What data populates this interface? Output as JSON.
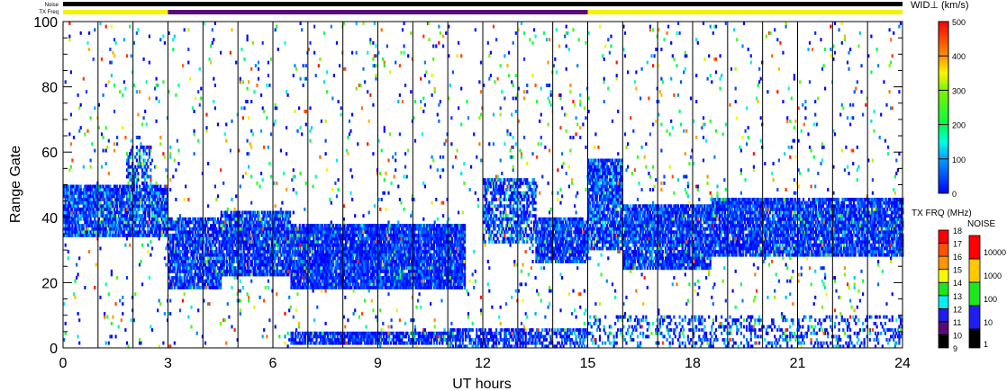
{
  "chart_data": {
    "type": "heatmap",
    "title": "",
    "xlabel": "UT hours",
    "ylabel": "Range Gate",
    "xlim": [
      0,
      24
    ],
    "ylim": [
      0,
      100
    ],
    "x_ticks": [
      "0",
      "3",
      "6",
      "9",
      "12",
      "15",
      "18",
      "21",
      "24"
    ],
    "y_ticks": [
      "0",
      "20",
      "40",
      "60",
      "80",
      "100"
    ],
    "hour_gridlines": true,
    "status_bars": {
      "noise_label": "Noise",
      "txfreq_label": "TX Freq",
      "noise_segments": [
        {
          "from": 0,
          "to": 24,
          "color": "#000000"
        }
      ],
      "txfreq_segments": [
        {
          "from": 0,
          "to": 3,
          "color": "#f2f200"
        },
        {
          "from": 3,
          "to": 15,
          "color": "#5a0a78"
        },
        {
          "from": 15,
          "to": 24,
          "color": "#f2f200"
        }
      ]
    },
    "parameter": {
      "label": "WID⊥ (km/s)",
      "range": [
        0,
        500
      ],
      "ticks": [
        "0",
        "100",
        "200",
        "300",
        "400",
        "500"
      ]
    },
    "scatter_regions": [
      {
        "t0": 0,
        "t1": 3,
        "g0": 34,
        "g1": 50,
        "density": 0.85,
        "width": [
          0,
          150
        ]
      },
      {
        "t0": 1.8,
        "t1": 2.5,
        "g0": 50,
        "g1": 62,
        "density": 0.5,
        "width": [
          0,
          200
        ]
      },
      {
        "t0": 3,
        "t1": 4.5,
        "g0": 18,
        "g1": 40,
        "density": 0.8,
        "width": [
          0,
          120
        ]
      },
      {
        "t0": 4.5,
        "t1": 6.5,
        "g0": 22,
        "g1": 42,
        "density": 0.85,
        "width": [
          0,
          120
        ]
      },
      {
        "t0": 6.5,
        "t1": 11.5,
        "g0": 18,
        "g1": 38,
        "density": 0.9,
        "width": [
          0,
          100
        ]
      },
      {
        "t0": 6.5,
        "t1": 11,
        "g0": 1,
        "g1": 5,
        "density": 0.8,
        "width": [
          0,
          80
        ]
      },
      {
        "t0": 11,
        "t1": 15,
        "g0": 0,
        "g1": 6,
        "density": 0.6,
        "width": [
          0,
          120
        ]
      },
      {
        "t0": 12,
        "t1": 13.5,
        "g0": 32,
        "g1": 52,
        "density": 0.6,
        "width": [
          0,
          150
        ]
      },
      {
        "t0": 13.5,
        "t1": 15,
        "g0": 26,
        "g1": 40,
        "density": 0.85,
        "width": [
          0,
          120
        ]
      },
      {
        "t0": 15,
        "t1": 16,
        "g0": 30,
        "g1": 58,
        "density": 0.8,
        "width": [
          0,
          150
        ]
      },
      {
        "t0": 16,
        "t1": 18.5,
        "g0": 24,
        "g1": 44,
        "density": 0.85,
        "width": [
          0,
          120
        ]
      },
      {
        "t0": 18.5,
        "t1": 24,
        "g0": 28,
        "g1": 46,
        "density": 0.85,
        "width": [
          0,
          120
        ]
      },
      {
        "t0": 15,
        "t1": 24,
        "g0": 0,
        "g1": 10,
        "density": 0.25,
        "width": [
          0,
          150
        ]
      },
      {
        "t0": 0,
        "t1": 24,
        "g0": 0,
        "g1": 100,
        "density": 0.03,
        "width": [
          0,
          500
        ]
      }
    ],
    "txfreq_scale": {
      "label": "TX FRQ (MHz)",
      "ticks": [
        "9",
        "10",
        "11",
        "12",
        "13",
        "14",
        "15",
        "16",
        "17",
        "18"
      ],
      "colors": [
        "#000000",
        "#5a0a78",
        "#1e1ef0",
        "#00f0f0",
        "#1ee61e",
        "#f8f800",
        "#ff9600",
        "#ff5000",
        "#ff0000"
      ]
    },
    "noise_scale": {
      "label": "NOISE",
      "ticks": [
        "1",
        "10",
        "100",
        "1000",
        "10000"
      ],
      "colors": [
        "#000000",
        "#1e1ef0",
        "#1ee61e",
        "#ffc800",
        "#ff0000"
      ]
    }
  }
}
